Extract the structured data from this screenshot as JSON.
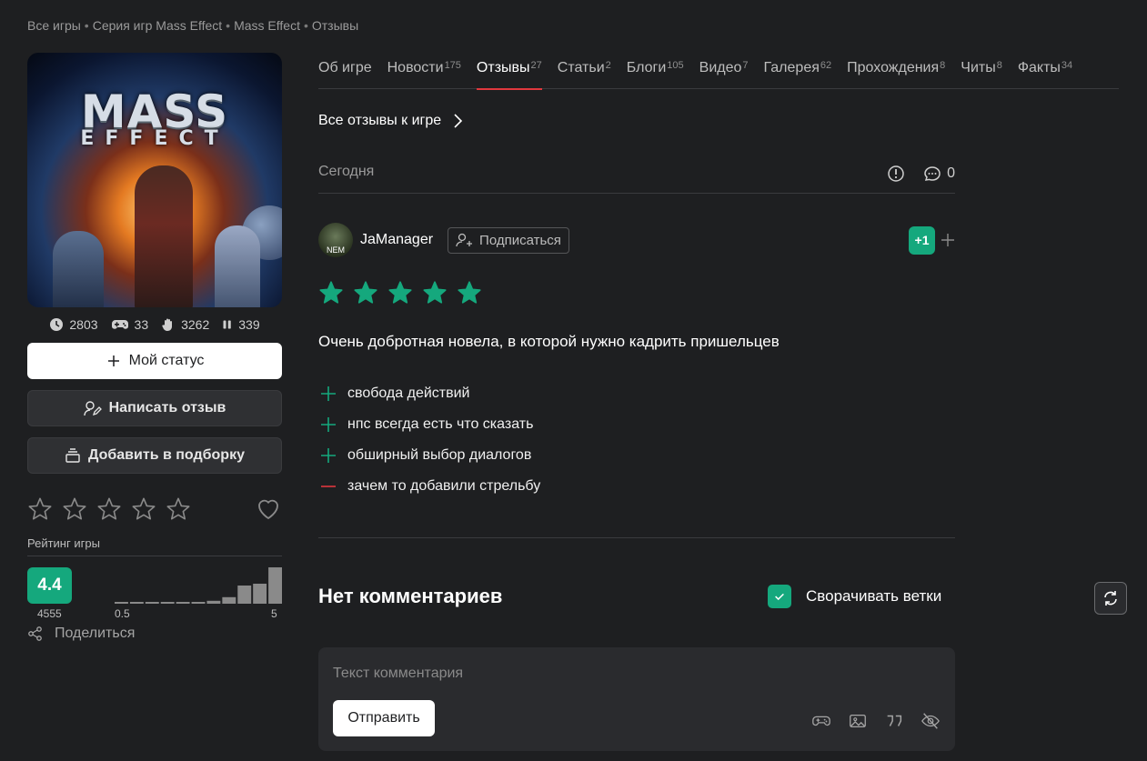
{
  "breadcrumb": [
    {
      "label": "Все игры"
    },
    {
      "label": "Серия игр Mass Effect"
    },
    {
      "label": "Mass Effect"
    },
    {
      "label": "Отзывы"
    }
  ],
  "breadcrumb_sep": "•",
  "game": {
    "cover_title_line1": "MASS",
    "cover_title_line2": "EFFECT",
    "stats": {
      "playtime": "2803",
      "playing": "33",
      "completed": "3262",
      "paused": "339"
    },
    "status_button": "Мой статус",
    "write_review_button": "Написать отзыв",
    "add_to_collection_button": "Добавить в подборку",
    "rating_title": "Рейтинг игры",
    "rating_value": "4.4",
    "rating_count": "4555",
    "hist_min": "0.5",
    "hist_max": "5",
    "histogram": [
      0.02,
      0.02,
      0.02,
      0.02,
      0.03,
      0.03,
      0.08,
      0.18,
      0.5,
      0.55,
      1.0
    ],
    "share_label": "Поделиться"
  },
  "tabs": [
    {
      "label": "Об игре",
      "count": ""
    },
    {
      "label": "Новости",
      "count": "175"
    },
    {
      "label": "Отзывы",
      "count": "27",
      "active": true
    },
    {
      "label": "Статьи",
      "count": "2"
    },
    {
      "label": "Блоги",
      "count": "105"
    },
    {
      "label": "Видео",
      "count": "7"
    },
    {
      "label": "Галерея",
      "count": "62"
    },
    {
      "label": "Прохождения",
      "count": "8"
    },
    {
      "label": "Читы",
      "count": "8"
    },
    {
      "label": "Факты",
      "count": "34"
    }
  ],
  "all_reviews_link": "Все отзывы к игре",
  "review": {
    "date": "Сегодня",
    "comments_count": "0",
    "author": "JaManager",
    "avatar_text": "NEM",
    "subscribe_label": "Подписаться",
    "vote": "+1",
    "stars": 5,
    "text": "Очень добротная новела, в которой нужно кадрить пришельцев",
    "points": [
      {
        "type": "pro",
        "text": "свобода действий"
      },
      {
        "type": "pro",
        "text": "нпс всегда есть что сказать"
      },
      {
        "type": "pro",
        "text": "обширный выбор диалогов"
      },
      {
        "type": "con",
        "text": "зачем то добавили стрельбу"
      }
    ]
  },
  "comments": {
    "title": "Нет комментариев",
    "collapse_label": "Сворачивать ветки",
    "collapse_checked": true,
    "input_placeholder": "Текст комментария",
    "send_button": "Отправить"
  },
  "colors": {
    "accent_green": "#15a87d",
    "active_tab_underline": "#e0383e",
    "con_red": "#e0383e",
    "background": "#1e1f21"
  }
}
